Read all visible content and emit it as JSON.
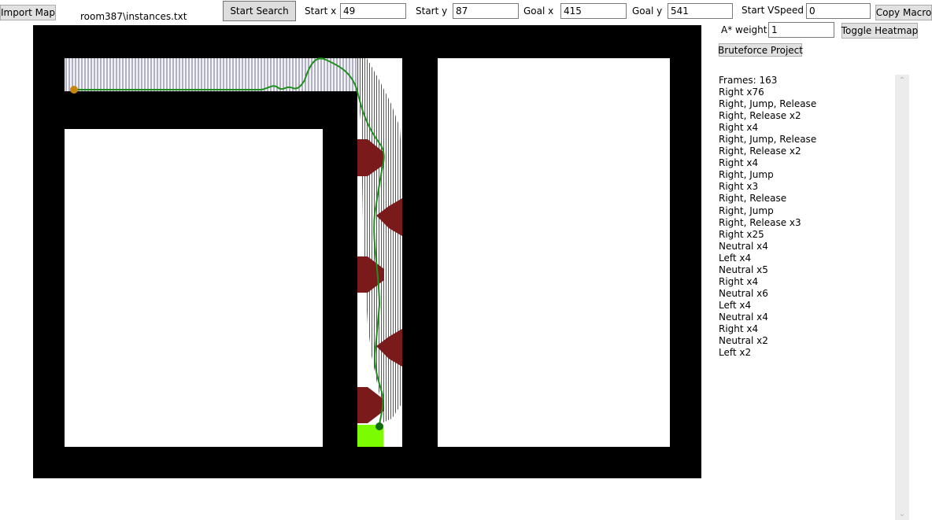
{
  "toolbar": {
    "import_label": "Import Map",
    "file_path": "room387\\instances.txt",
    "start_search_label": "Start Search",
    "start_x_label": "Start x",
    "start_x_value": "49",
    "start_y_label": "Start y",
    "start_y_value": "87",
    "goal_x_label": "Goal x",
    "goal_x_value": "415",
    "goal_y_label": "Goal y",
    "goal_y_value": "541",
    "start_vspeed_label": "Start VSpeed",
    "start_vspeed_value": "0",
    "copy_macro_label": "Copy Macro",
    "astar_weight_label": "A* weight",
    "astar_weight_value": "1",
    "toggle_heatmap_label": "Toggle Heatmap",
    "bruteforce_label": "Bruteforce Project"
  },
  "results": {
    "lines": [
      "Frames: 163",
      "Right x76",
      "Right, Jump, Release",
      "Right, Release x2",
      "Right x4",
      "Right, Jump, Release",
      "Right, Release x2",
      "Right x4",
      "Right, Jump",
      "Right x3",
      "Right, Release",
      "Right, Jump",
      "Right, Release x3",
      "Right x25",
      "Neutral x4",
      "Left x4",
      "Neutral x5",
      "Right x4",
      "Neutral x6",
      "Left x4",
      "Neutral x4",
      "Right x4",
      "Neutral x2",
      "Left x2"
    ]
  },
  "map": {
    "wall_color": "#000000",
    "spike_color": "#7a1a1a",
    "goal_color": "#7cfc00",
    "path_color": "#1f8f1f",
    "start_marker_color": "#c8860a",
    "goal_marker_color": "#0f6b0f"
  },
  "icons": {
    "scroll_up": "chevron-up-icon",
    "scroll_down": "chevron-down-icon"
  }
}
